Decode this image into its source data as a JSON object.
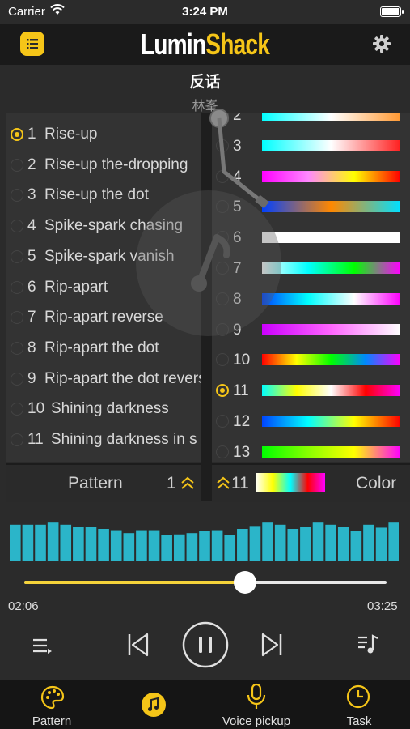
{
  "status": {
    "carrier": "Carrier",
    "time": "3:24 PM"
  },
  "header": {
    "logo_white": "Lumin",
    "logo_yellow": "Shack"
  },
  "song": {
    "title": "反话",
    "artist": "林峯"
  },
  "patterns": [
    {
      "num": "1",
      "name": "Rise-up",
      "selected": true
    },
    {
      "num": "2",
      "name": "Rise-up the-dropping",
      "selected": false
    },
    {
      "num": "3",
      "name": "Rise-up the dot",
      "selected": false
    },
    {
      "num": "4",
      "name": "Spike-spark chasing",
      "selected": false
    },
    {
      "num": "5",
      "name": "Spike-spark vanish",
      "selected": false
    },
    {
      "num": "6",
      "name": "Rip-apart",
      "selected": false
    },
    {
      "num": "7",
      "name": "Rip-apart reverse",
      "selected": false
    },
    {
      "num": "8",
      "name": "Rip-apart the dot",
      "selected": false
    },
    {
      "num": "9",
      "name": "Rip-apart the dot reverse",
      "selected": false
    },
    {
      "num": "10",
      "name": "Shining darkness",
      "selected": false
    },
    {
      "num": "11",
      "name": "Shining darkness in s",
      "selected": false
    }
  ],
  "colors": [
    {
      "num": "2",
      "stops": [
        "#00ffff",
        "#ffffff",
        "#ff9933"
      ],
      "selected": false
    },
    {
      "num": "3",
      "stops": [
        "#00ffff",
        "#ffffff",
        "#ff2020"
      ],
      "selected": false
    },
    {
      "num": "4",
      "stops": [
        "#ff00ff",
        "#ff88ff",
        "#ffff00",
        "#ff0000"
      ],
      "selected": false
    },
    {
      "num": "5",
      "stops": [
        "#0040ff",
        "#ff8800",
        "#00e0ff"
      ],
      "selected": false
    },
    {
      "num": "6",
      "stops": [
        "#ffffff",
        "#ffffff"
      ],
      "selected": false
    },
    {
      "num": "7",
      "stops": [
        "#ffffff",
        "#00ffff",
        "#00ff00",
        "#ff00ff"
      ],
      "selected": false
    },
    {
      "num": "8",
      "stops": [
        "#0044ff",
        "#00ffff",
        "#ffffff",
        "#ff00ff"
      ],
      "selected": false
    },
    {
      "num": "9",
      "stops": [
        "#cc00ff",
        "#ff66ff",
        "#ffffff"
      ],
      "selected": false
    },
    {
      "num": "10",
      "stops": [
        "#ff0000",
        "#ffff00",
        "#00ff00",
        "#0088ff",
        "#ff00ff"
      ],
      "selected": false
    },
    {
      "num": "11",
      "stops": [
        "#00ffff",
        "#ffff00",
        "#ffffff",
        "#ff0000",
        "#ff00ff"
      ],
      "selected": true
    },
    {
      "num": "12",
      "stops": [
        "#0044ff",
        "#00ffff",
        "#ffff00",
        "#ff0000"
      ],
      "selected": false
    },
    {
      "num": "13",
      "stops": [
        "#00ff00",
        "#88ff00",
        "#ffff00",
        "#ff00ff"
      ],
      "selected": false
    }
  ],
  "pattern_selector": {
    "label": "Pattern",
    "value": "1"
  },
  "color_selector": {
    "label": "Color",
    "value": "11",
    "swatch_stops": [
      "#ffffff",
      "#ffff00",
      "#00ffff",
      "#ff0000",
      "#ff00ff"
    ]
  },
  "visualizer": {
    "levels": [
      0.85,
      0.85,
      0.85,
      0.9,
      0.85,
      0.8,
      0.8,
      0.75,
      0.72,
      0.65,
      0.72,
      0.72,
      0.6,
      0.62,
      0.65,
      0.7,
      0.72,
      0.6,
      0.75,
      0.82,
      0.9,
      0.85,
      0.75,
      0.8,
      0.9,
      0.85,
      0.8,
      0.7,
      0.85,
      0.78,
      0.9
    ],
    "color": "#2bb5c9"
  },
  "player": {
    "current": "02:06",
    "total": "03:25",
    "progress": 0.61
  },
  "tabs": [
    {
      "label": "Pattern",
      "icon": "palette-icon"
    },
    {
      "label": "",
      "icon": "music-note-icon"
    },
    {
      "label": "Voice pickup",
      "icon": "microphone-icon"
    },
    {
      "label": "Task",
      "icon": "clock-icon"
    }
  ],
  "accent": "#f5c518"
}
